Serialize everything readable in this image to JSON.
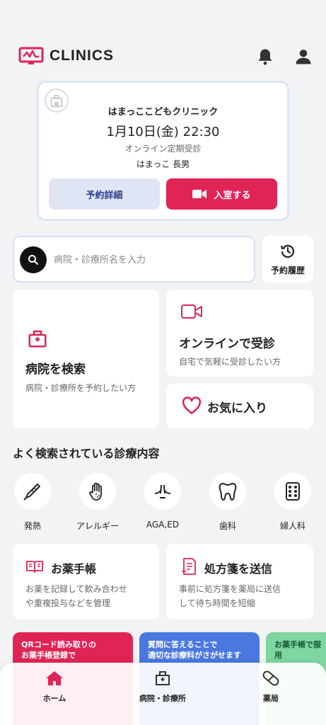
{
  "brand": {
    "name": "CLINICS",
    "color": "#e02456"
  },
  "appointment": {
    "clinic": "はまっここどもクリニック",
    "datetime": "1月10日(金) 22:30",
    "type": "オンライン定期受診",
    "patient": "はまっこ 長男",
    "detail_label": "予約詳細",
    "enter_label": "入室する"
  },
  "search": {
    "placeholder": "病院・診療所名を入力"
  },
  "history_label": "予約履歴",
  "cards": {
    "hospital": {
      "title": "病院を検索",
      "sub": "病院・診療所を予約したい方"
    },
    "online": {
      "title": "オンラインで受診",
      "sub": "自宅で気軽に受診したい方"
    },
    "favorite": {
      "title": "お気に入り"
    },
    "notebook": {
      "title": "お薬手帳",
      "sub1": "お薬を記録して飲み合わせ",
      "sub2": "や重複投与などを管理"
    },
    "prescription": {
      "title": "処方箋を送信",
      "sub1": "事前に処方箋を薬局に送信",
      "sub2": "して待ち時間を短縮"
    }
  },
  "popular": {
    "title": "よく検索されている診療内容",
    "items": [
      {
        "label": "発熱",
        "icon": "thermometer-icon"
      },
      {
        "label": "アレルギー",
        "icon": "hand-icon"
      },
      {
        "label": "AGA,ED",
        "icon": "hair-icon"
      },
      {
        "label": "歯科",
        "icon": "tooth-icon"
      },
      {
        "label": "婦人科",
        "icon": "pill-pack-icon"
      }
    ]
  },
  "banners": [
    {
      "line1": "QRコード読み取りの",
      "line2": "お薬手帳登録で",
      "color": "#e02456"
    },
    {
      "line1": "質問に答えることで",
      "line2": "適切な診療科がさがせます",
      "color": "#4a78e0"
    },
    {
      "line1": "お薬手帳で服用",
      "line2": "",
      "color": "#7ed6a0"
    }
  ],
  "tabs": [
    {
      "label": "ホーム",
      "icon": "home-icon"
    },
    {
      "label": "病院・診療所",
      "icon": "hospital-icon"
    },
    {
      "label": "薬局",
      "icon": "pill-icon"
    }
  ]
}
